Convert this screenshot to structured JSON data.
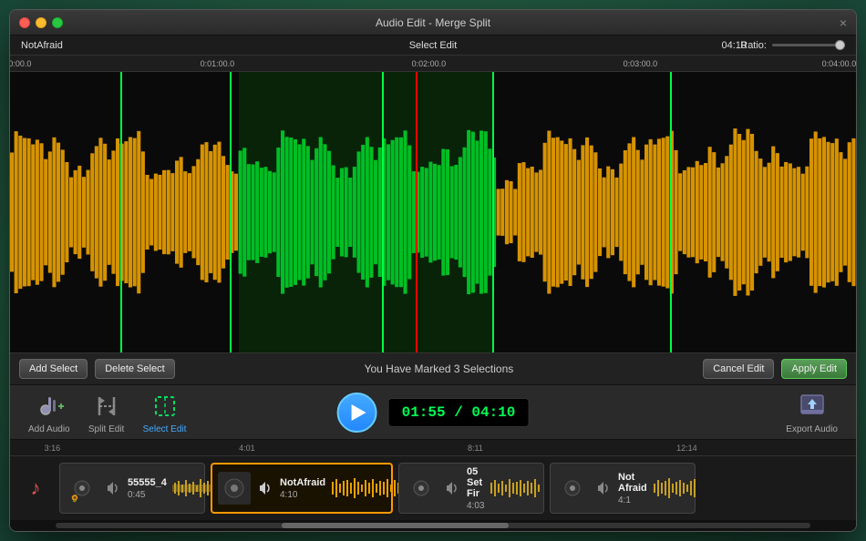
{
  "window": {
    "title": "Audio Edit - Merge Split",
    "close_icon": "×"
  },
  "info_bar": {
    "track_name": "NotAfraid",
    "select_edit_label": "Select Edit",
    "time_display": "04:10",
    "ratio_label": "Ratio:"
  },
  "ruler": {
    "marks": [
      {
        "time": "0:00:00.0",
        "pct": 0
      },
      {
        "time": "0:01:00.0",
        "pct": 25
      },
      {
        "time": "0:02:00.0",
        "pct": 50
      },
      {
        "time": "0:03:00.0",
        "pct": 75
      },
      {
        "time": "0:04:00.0",
        "pct": 100
      }
    ]
  },
  "controls": {
    "add_select": "Add Select",
    "delete_select": "Delete Select",
    "status": "You Have Marked 3 Selections",
    "cancel_edit": "Cancel Edit",
    "apply_edit": "Apply Edit"
  },
  "toolbar": {
    "add_audio_label": "Add Audio",
    "split_edit_label": "Split Edit",
    "select_edit_label": "Select Edit",
    "export_audio_label": "Export Audio",
    "time_current": "01:55",
    "time_total": "04:10",
    "time_separator": " / ",
    "time_display": "01:55 / 04:10"
  },
  "mini_timeline": {
    "marks": [
      {
        "label": "3:16",
        "pct": 5
      },
      {
        "label": "4:01",
        "pct": 28
      },
      {
        "label": "8:11",
        "pct": 55
      },
      {
        "label": "12:14",
        "pct": 80
      }
    ]
  },
  "tracks": [
    {
      "id": 1,
      "title": "55555_4",
      "duration": "0:45",
      "active": false,
      "color": "#c8a020"
    },
    {
      "id": 2,
      "title": "NotAfraid",
      "duration": "4:10",
      "active": true,
      "color": "#f90"
    },
    {
      "id": 3,
      "title": "05 Set Fir",
      "duration": "4:03",
      "active": false,
      "color": "#c8a020"
    },
    {
      "id": 4,
      "title": "Not Afraid",
      "duration": "4:1",
      "active": false,
      "color": "#c8a020"
    }
  ]
}
